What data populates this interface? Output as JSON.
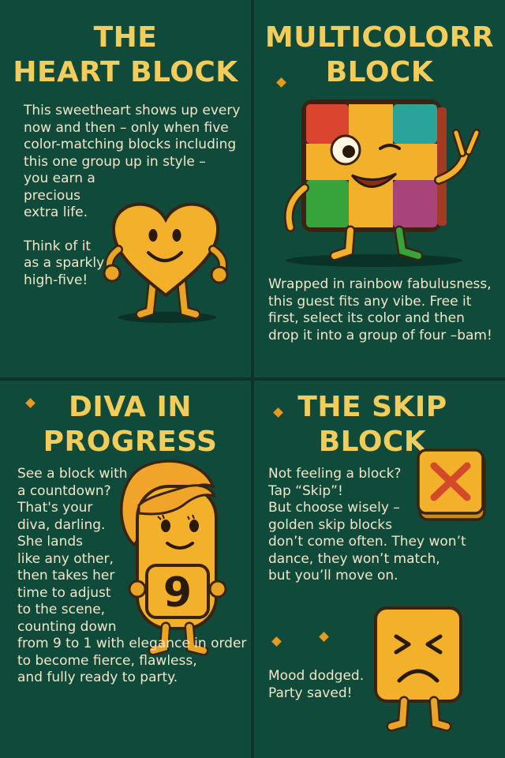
{
  "panels": [
    {
      "title_lines": [
        "THE",
        "HEART BLOCK"
      ],
      "body_lines": [
        "This sweetheart shows up every",
        "now and then – only when five",
        "color-matching blocks including",
        "this one group up in style –",
        "you earn a",
        "precious",
        "extra life."
      ],
      "body2_lines": [
        "Think of it",
        "as a sparkly",
        "high-five!"
      ],
      "illustration": "heart-block-character"
    },
    {
      "title_lines": [
        "MULTICOLORR",
        "BLOCK"
      ],
      "body_lines": [
        "Wrapped in rainbow fabulusness,",
        "this guest fits any vibe. Free it",
        "first, select its color and then",
        "drop it into a group of four –bam!"
      ],
      "illustration": "multicolor-block-character"
    },
    {
      "title_lines": [
        "DIVA IN",
        "PROGRESS"
      ],
      "body_lines": [
        "See a block with",
        "a countdown?",
        "That's your",
        "diva, darling.",
        "She lands",
        "like any other,",
        "then takes her",
        "time to adjust",
        "to the scene,",
        "counting down",
        "from 9 to 1 with elegance in order",
        "to become fierce, flawless,",
        "and fully ready to party."
      ],
      "countdown": "9",
      "illustration": "diva-block-character"
    },
    {
      "title_lines": [
        "THE SKIP",
        "BLOCK"
      ],
      "body_lines": [
        "Not feeling a block?",
        "Tap “Skip”!",
        "But choose wisely –",
        "golden skip blocks",
        "don’t come often. They won’t",
        "dance, they won’t match,",
        "but you’ll move on."
      ],
      "body2_lines": [
        "Mood dodged.",
        "Party saved!"
      ],
      "illustration": "skip-block-character"
    }
  ],
  "colors": {
    "panel_bg": "#0f4a3a",
    "divider": "#0c342a",
    "title": "#f3cc5a",
    "body_text": "#f2e6c9",
    "block_gold": "#f2b02b",
    "outline": "#3a2410",
    "sparkle": "#e89a1e"
  }
}
